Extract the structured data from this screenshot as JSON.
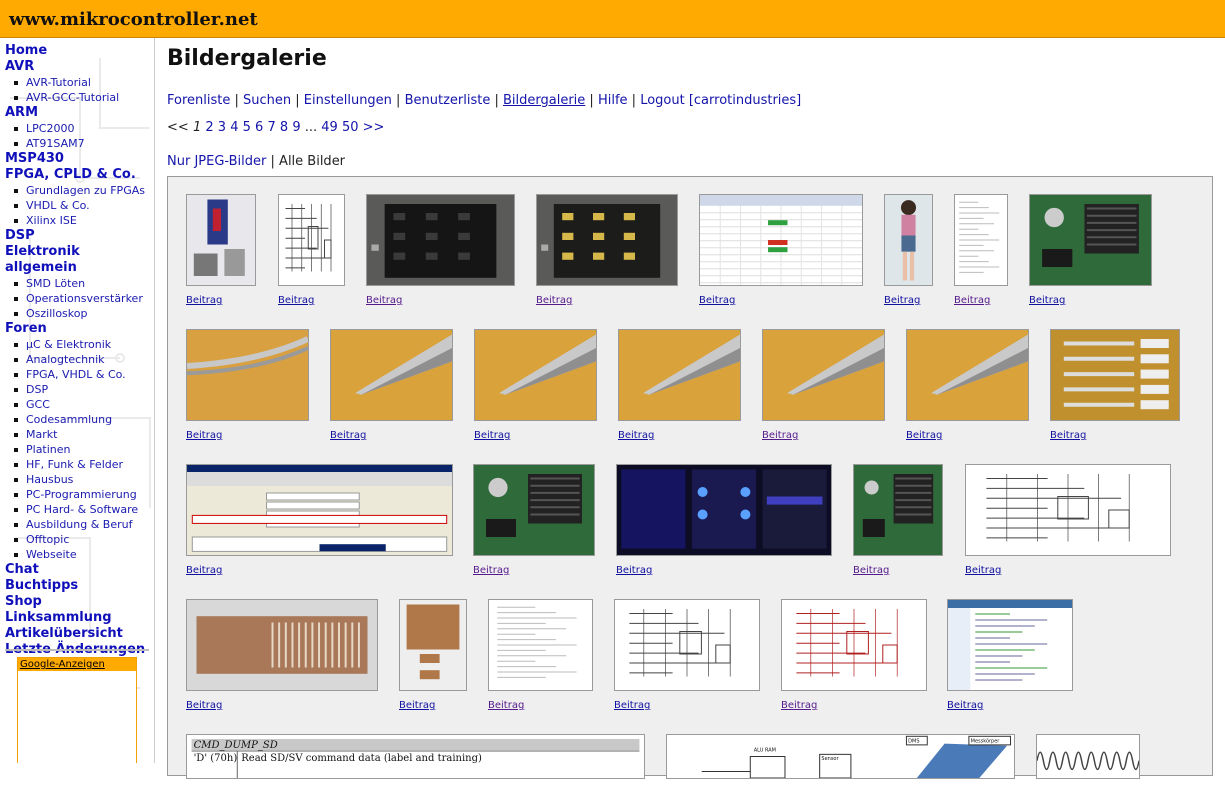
{
  "header": {
    "site_title": "www.mikrocontroller.net"
  },
  "sidebar": {
    "nav": [
      {
        "label": "Home",
        "level": 0
      },
      {
        "label": "AVR",
        "level": 0
      },
      {
        "label": "AVR-Tutorial",
        "level": 1
      },
      {
        "label": "AVR-GCC-Tutorial",
        "level": 1
      },
      {
        "label": "ARM",
        "level": 0
      },
      {
        "label": "LPC2000",
        "level": 1
      },
      {
        "label": "AT91SAM7",
        "level": 1
      },
      {
        "label": "MSP430",
        "level": 0
      },
      {
        "label": "FPGA, CPLD & Co.",
        "level": 0
      },
      {
        "label": "Grundlagen zu FPGAs",
        "level": 1
      },
      {
        "label": "VHDL & Co.",
        "level": 1
      },
      {
        "label": "Xilinx ISE",
        "level": 1
      },
      {
        "label": "DSP",
        "level": 0
      },
      {
        "label": "Elektronik allgemein",
        "level": 0
      },
      {
        "label": "SMD Löten",
        "level": 1
      },
      {
        "label": "Operationsverstärker",
        "level": 1
      },
      {
        "label": "Oszilloskop",
        "level": 1
      },
      {
        "label": "Foren",
        "level": 0
      },
      {
        "label": "µC & Elektronik",
        "level": 1
      },
      {
        "label": "Analogtechnik",
        "level": 1
      },
      {
        "label": "FPGA, VHDL & Co.",
        "level": 1
      },
      {
        "label": "DSP",
        "level": 1
      },
      {
        "label": "GCC",
        "level": 1
      },
      {
        "label": "Codesammlung",
        "level": 1
      },
      {
        "label": "Markt",
        "level": 1
      },
      {
        "label": "Platinen",
        "level": 1
      },
      {
        "label": "HF, Funk & Felder",
        "level": 1
      },
      {
        "label": "Hausbus",
        "level": 1
      },
      {
        "label": "PC-Programmierung",
        "level": 1
      },
      {
        "label": "PC Hard- & Software",
        "level": 1
      },
      {
        "label": "Ausbildung & Beruf",
        "level": 1
      },
      {
        "label": "Offtopic",
        "level": 1
      },
      {
        "label": "Webseite",
        "level": 1
      },
      {
        "label": "Chat",
        "level": 0
      },
      {
        "label": "Buchtipps",
        "level": 0
      },
      {
        "label": "Shop",
        "level": 0
      },
      {
        "label": "Linksammlung",
        "level": 0
      },
      {
        "label": "Artikelübersicht",
        "level": 0
      },
      {
        "label": "Letzte Änderungen",
        "level": 0
      }
    ],
    "ads_label": "Google-Anzeigen"
  },
  "main": {
    "title": "Bildergalerie",
    "forum_nav": [
      {
        "label": "Forenliste"
      },
      {
        "label": "Suchen"
      },
      {
        "label": "Einstellungen"
      },
      {
        "label": "Benutzerliste"
      },
      {
        "label": "Bildergalerie",
        "current": true
      },
      {
        "label": "Hilfe"
      },
      {
        "label": "Logout [carrotindustries]"
      }
    ],
    "pager": {
      "prev": "<<",
      "current": "1",
      "pages": [
        "2",
        "3",
        "4",
        "5",
        "6",
        "7",
        "8",
        "9"
      ],
      "ellipsis": "...",
      "last_pages": [
        "49",
        "50"
      ],
      "next": ">>"
    },
    "filter": {
      "jpeg_label": "Nur JPEG-Bilder",
      "separator": "|",
      "all_label": "Alle Bilder"
    },
    "gallery_rows": [
      [
        {
          "caption": "Beitrag",
          "kind": "photo-kit",
          "visited": false
        },
        {
          "caption": "Beitrag",
          "kind": "schematic",
          "visited": false
        },
        {
          "caption": "Beitrag",
          "kind": "pcb-dark",
          "visited": true
        },
        {
          "caption": "Beitrag",
          "kind": "pcb-gold",
          "visited": true
        },
        {
          "caption": "Beitrag",
          "kind": "spreadsheet",
          "visited": false
        },
        {
          "caption": "Beitrag",
          "kind": "figure",
          "visited": false
        },
        {
          "caption": "Beitrag",
          "kind": "document",
          "visited": true
        },
        {
          "caption": "Beitrag",
          "kind": "board-green",
          "visited": false
        }
      ],
      [
        {
          "caption": "Beitrag",
          "kind": "tweezer",
          "visited": false
        },
        {
          "caption": "Beitrag",
          "kind": "tip",
          "visited": false
        },
        {
          "caption": "Beitrag",
          "kind": "tip",
          "visited": false
        },
        {
          "caption": "Beitrag",
          "kind": "tip",
          "visited": false
        },
        {
          "caption": "Beitrag",
          "kind": "tip",
          "visited": true
        },
        {
          "caption": "Beitrag",
          "kind": "tip",
          "visited": false
        },
        {
          "caption": "Beitrag",
          "kind": "tweezers",
          "visited": false
        }
      ],
      [
        {
          "caption": "Beitrag",
          "kind": "window",
          "visited": false
        },
        {
          "caption": "Beitrag",
          "kind": "board-green",
          "visited": true
        },
        {
          "caption": "Beitrag",
          "kind": "player",
          "visited": false
        },
        {
          "caption": "Beitrag",
          "kind": "board-green",
          "visited": true
        },
        {
          "caption": "Beitrag",
          "kind": "schematic-wide",
          "visited": false
        }
      ],
      [
        {
          "caption": "Beitrag",
          "kind": "connector",
          "visited": false
        },
        {
          "caption": "Beitrag",
          "kind": "pcb-copper",
          "visited": false
        },
        {
          "caption": "Beitrag",
          "kind": "document",
          "visited": true
        },
        {
          "caption": "Beitrag",
          "kind": "schematic",
          "visited": false
        },
        {
          "caption": "Beitrag",
          "kind": "schematic-red",
          "visited": true
        },
        {
          "caption": "Beitrag",
          "kind": "ide",
          "visited": false
        }
      ],
      [
        {
          "caption": "",
          "kind": "cmd-table",
          "visited": false,
          "lines": [
            "CMD_DUMP_SD",
            "'D' (70h)",
            "Read SD/SV command data (label and training)"
          ]
        },
        {
          "caption": "",
          "kind": "block-diagram",
          "visited": false,
          "labels": [
            "ALU RAM",
            "Sensor",
            "DMS",
            "Messkörper"
          ]
        },
        {
          "caption": "",
          "kind": "waveform",
          "visited": false
        }
      ]
    ]
  },
  "colors": {
    "header": "#ffaa00",
    "link": "#1414aa",
    "visited": "#551a8b"
  }
}
